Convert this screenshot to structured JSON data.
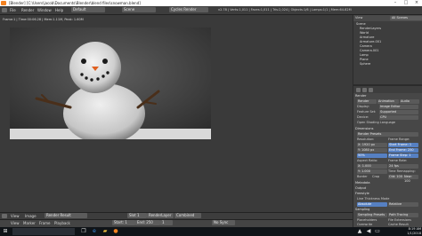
{
  "window": {
    "title": "[Blender] [C:\\Users\\jacob\\Documents\\Blender\\blend files\\snowman.blend]"
  },
  "info_header": {
    "menus": [
      "File",
      "Render",
      "Window",
      "Help"
    ],
    "layout": "Default",
    "scene": "Scene",
    "engine": "Cycles Render",
    "stats": "v2.78 | Verts:1,011 | Faces:1,011 | Tris:2,024 | Objects:1/6 | Lamps:1/1 | Mem:64.82M"
  },
  "image_editor": {
    "stats": "Frame:1 | Time:00:06.28 | Mem:1.11M, Peak: 1.60M",
    "header": {
      "menus": [
        "View",
        "Image"
      ],
      "image_name": "Render Result",
      "slot": "Slot 1",
      "layer": "RenderLayer",
      "pass": "Combined"
    }
  },
  "timeline": {
    "menus": [
      "View",
      "Marker",
      "Frame",
      "Playback"
    ],
    "start": "Start: 1",
    "end": "End: 250",
    "current": "1",
    "sync": "No Sync"
  },
  "outliner": {
    "view": "View",
    "search": "All Scenes",
    "items": [
      "Scene",
      "RenderLayers",
      "World",
      "Armature",
      "Armature.001",
      "Camera",
      "Camera.001",
      "Lamp",
      "Plane",
      "Sphere"
    ]
  },
  "properties": {
    "tabs": [
      "Render",
      "Animation",
      "Audio"
    ],
    "render_buttons": [
      "Render",
      "Animation",
      "Audio"
    ],
    "display_label": "Display:",
    "display_value": "Image Editor",
    "feature_set_label": "Feature Set:",
    "feature_set_value": "Supported",
    "device_label": "Device:",
    "device_value": "CPU",
    "osl_label": "Open Shading Language",
    "dimensions_header": "Dimensions",
    "render_presets": "Render Presets",
    "resolution_label": "Resolution:",
    "res_x": "X: 1920 px",
    "res_y": "Y: 1080 px",
    "res_pct": "50%",
    "frame_range_label": "Frame Range:",
    "start_frame": "Start Frame: 1",
    "end_frame": "End Frame: 250",
    "frame_step": "Frame Step: 1",
    "aspect_label": "Aspect Ratio:",
    "aspect_x": "X: 1.000",
    "aspect_y": "Y: 1.000",
    "frame_rate_label": "Frame Rate:",
    "frame_rate": "24 fps",
    "border_label": "Border",
    "crop_label": "Crop",
    "time_remap_label": "Time Remapping:",
    "old_new": "Old: 100",
    "new": "New: 100",
    "metadata_header": "Metadata",
    "output_header": "Output",
    "freestyle_header": "Freestyle",
    "line_thickness": "Line Thickness Mode",
    "absolute": "Absolute",
    "relative": "Relative",
    "sampling_header": "Sampling",
    "presets": "Sampling Presets",
    "path_tracing": "Path Tracing",
    "file_extensions": "File Extensions",
    "cache_result": "Cache Result",
    "placeholders": "Placeholders",
    "overwrite": "Overwrite"
  },
  "taskbar": {
    "time": "8:19 AM",
    "date": "1/1/2018"
  }
}
